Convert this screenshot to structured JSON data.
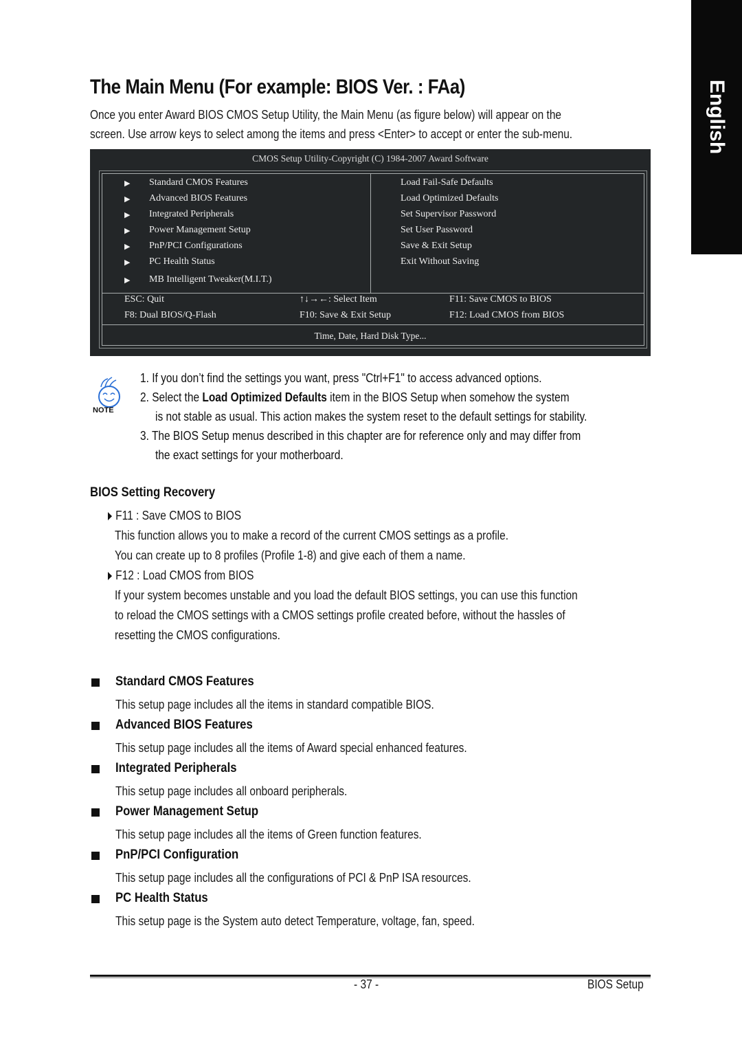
{
  "side_tab": {
    "label": "English"
  },
  "title": "The Main Menu (For example: BIOS Ver. : FAa)",
  "intro": [
    "Once you enter Award BIOS CMOS Setup Utility, the Main Menu (as figure below) will appear on the",
    "screen.  Use arrow keys to select among the items and press <Enter> to accept or enter the sub-menu."
  ],
  "bios_screen": {
    "title": "CMOS Setup Utility-Copyright (C) 1984-2007 Award Software",
    "left_menu": [
      "Standard CMOS Features",
      "Advanced BIOS Features",
      "Integrated Peripherals",
      "Power Management Setup",
      "PnP/PCI Configurations",
      "PC Health Status",
      "MB Intelligent Tweaker(M.I.T.)"
    ],
    "right_menu": [
      "Load Fail-Safe Defaults",
      "Load Optimized Defaults",
      "Set Supervisor Password",
      "Set User Password",
      "Save & Exit Setup",
      "Exit Without Saving"
    ],
    "keys": [
      [
        "ESC: Quit",
        "↑↓→←: Select Item",
        "F11: Save CMOS to BIOS"
      ],
      [
        "F8: Dual BIOS/Q-Flash",
        "F10: Save & Exit Setup",
        "F12: Load CMOS from BIOS"
      ]
    ],
    "help_line": "Time, Date, Hard Disk Type...",
    "arrow_glyph": "▶"
  },
  "note": {
    "icon_label": "NOTE",
    "items": [
      {
        "num": "1.",
        "lines": [
          "If you don’t find the settings you want, press \"Ctrl+F1\" to access advanced options."
        ]
      },
      {
        "num": "2.",
        "pre": "Select the ",
        "bold": "Load Optimized Defaults",
        "post": " item in the BIOS Setup when somehow the system",
        "lines": [
          "is not stable as usual. This action makes the system reset to the default settings for stability."
        ]
      },
      {
        "num": "3.",
        "lines": [
          "The BIOS Setup menus described in this chapter are for reference only and may differ from",
          "the exact settings for your motherboard."
        ]
      }
    ]
  },
  "recovery": {
    "heading": "BIOS Setting Recovery",
    "f11_label": "F11 : Save CMOS to BIOS",
    "f11_text": [
      "This function allows you to make a record of the current CMOS settings as a profile.",
      "You can create up to 8 profiles (Profile 1-8) and give each of them a name."
    ],
    "f12_label": "F12 : Load CMOS from BIOS",
    "f12_text": [
      "If your system becomes unstable and you load the default BIOS settings, you can use this function",
      "to reload the CMOS settings with a CMOS settings profile created before, without the hassles of",
      "resetting the CMOS configurations."
    ]
  },
  "sections": [
    {
      "heading": "Standard CMOS Features",
      "text": "This setup page includes all the items in standard compatible BIOS."
    },
    {
      "heading": "Advanced BIOS Features",
      "text": "This setup page includes all the items of Award special enhanced features."
    },
    {
      "heading": "Integrated Peripherals",
      "text": "This setup page includes all onboard peripherals."
    },
    {
      "heading": "Power Management Setup",
      "text": "This setup page includes all the items of Green function features."
    },
    {
      "heading": "PnP/PCI Configuration",
      "text": "This setup page includes all the configurations of PCI & PnP ISA resources."
    },
    {
      "heading": "PC Health Status",
      "text": "This setup page is the System auto detect Temperature, voltage, fan, speed."
    }
  ],
  "footer": {
    "page_number": "- 37 -",
    "section": "BIOS Setup"
  },
  "colors": {
    "bios_bg": "#232628",
    "tab_bg": "#0a0a0a",
    "note_blue": "#2a6fd6"
  }
}
